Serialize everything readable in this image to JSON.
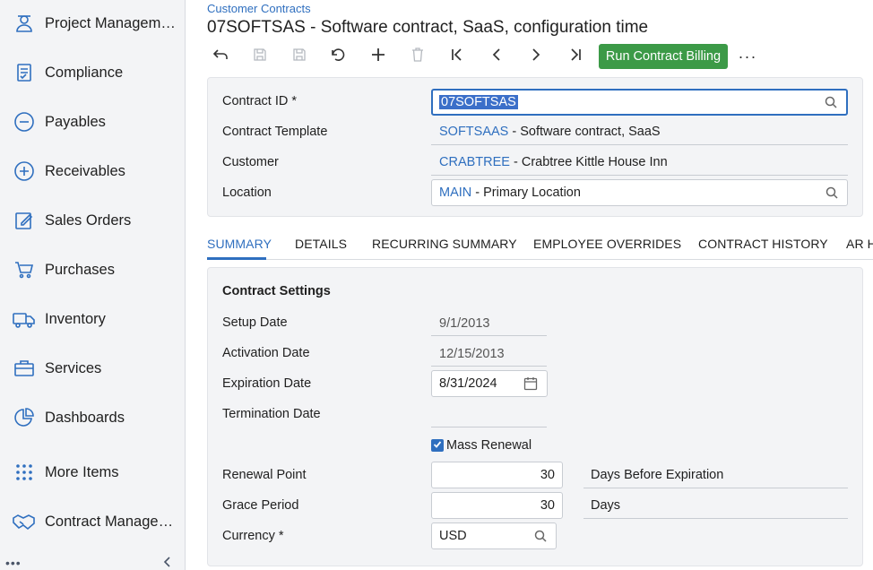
{
  "sidebar": {
    "items": [
      {
        "label": "Project Management",
        "icon": "project-management-icon"
      },
      {
        "label": "Compliance",
        "icon": "compliance-icon"
      },
      {
        "label": "Payables",
        "icon": "payables-icon"
      },
      {
        "label": "Receivables",
        "icon": "receivables-icon"
      },
      {
        "label": "Sales Orders",
        "icon": "sales-orders-icon"
      },
      {
        "label": "Purchases",
        "icon": "purchases-icon"
      },
      {
        "label": "Inventory",
        "icon": "inventory-icon"
      },
      {
        "label": "Services",
        "icon": "services-icon"
      },
      {
        "label": "Dashboards",
        "icon": "dashboards-icon"
      },
      {
        "label": "More Items",
        "icon": "more-items-icon"
      },
      {
        "label": "Contract Management",
        "icon": "contract-management-icon"
      }
    ],
    "bottom_dots": "•••"
  },
  "header": {
    "breadcrumb": "Customer Contracts",
    "title": "07SOFTSAS - Software contract, SaaS, configuration time"
  },
  "toolbar": {
    "run_billing_label": "Run Contract Billing",
    "more_label": "···"
  },
  "form": {
    "contract_id": {
      "label": "Contract ID *",
      "value": "07SOFTSAS"
    },
    "contract_template": {
      "label": "Contract Template",
      "code": "SOFTSAAS",
      "desc": " - Software contract, SaaS"
    },
    "customer": {
      "label": "Customer",
      "code": "CRABTREE",
      "desc": " - Crabtree Kittle House Inn"
    },
    "location": {
      "label": "Location",
      "code": "MAIN",
      "desc": " - Primary Location"
    }
  },
  "tabs": [
    {
      "label": "SUMMARY",
      "active": true
    },
    {
      "label": "DETAILS"
    },
    {
      "label": "RECURRING SUMMARY"
    },
    {
      "label": "EMPLOYEE OVERRIDES"
    },
    {
      "label": "CONTRACT HISTORY"
    },
    {
      "label": "AR H"
    }
  ],
  "contract_settings": {
    "title": "Contract Settings",
    "setup_date": {
      "label": "Setup Date",
      "value": "9/1/2013"
    },
    "activation_date": {
      "label": "Activation Date",
      "value": "12/15/2013"
    },
    "expiration_date": {
      "label": "Expiration Date",
      "value": "8/31/2024"
    },
    "termination_date": {
      "label": "Termination Date",
      "value": ""
    },
    "mass_renewal": {
      "label": "Mass Renewal",
      "checked": true
    },
    "renewal_point": {
      "label": "Renewal Point",
      "value": "30",
      "unit": "Days Before Expiration"
    },
    "grace_period": {
      "label": "Grace Period",
      "value": "30",
      "unit": "Days"
    },
    "currency": {
      "label": "Currency *",
      "value": "USD"
    }
  },
  "colors": {
    "accent": "#2f6fbf",
    "run_button": "#3c9a47",
    "sidebar_bg": "#f3f4f6"
  }
}
